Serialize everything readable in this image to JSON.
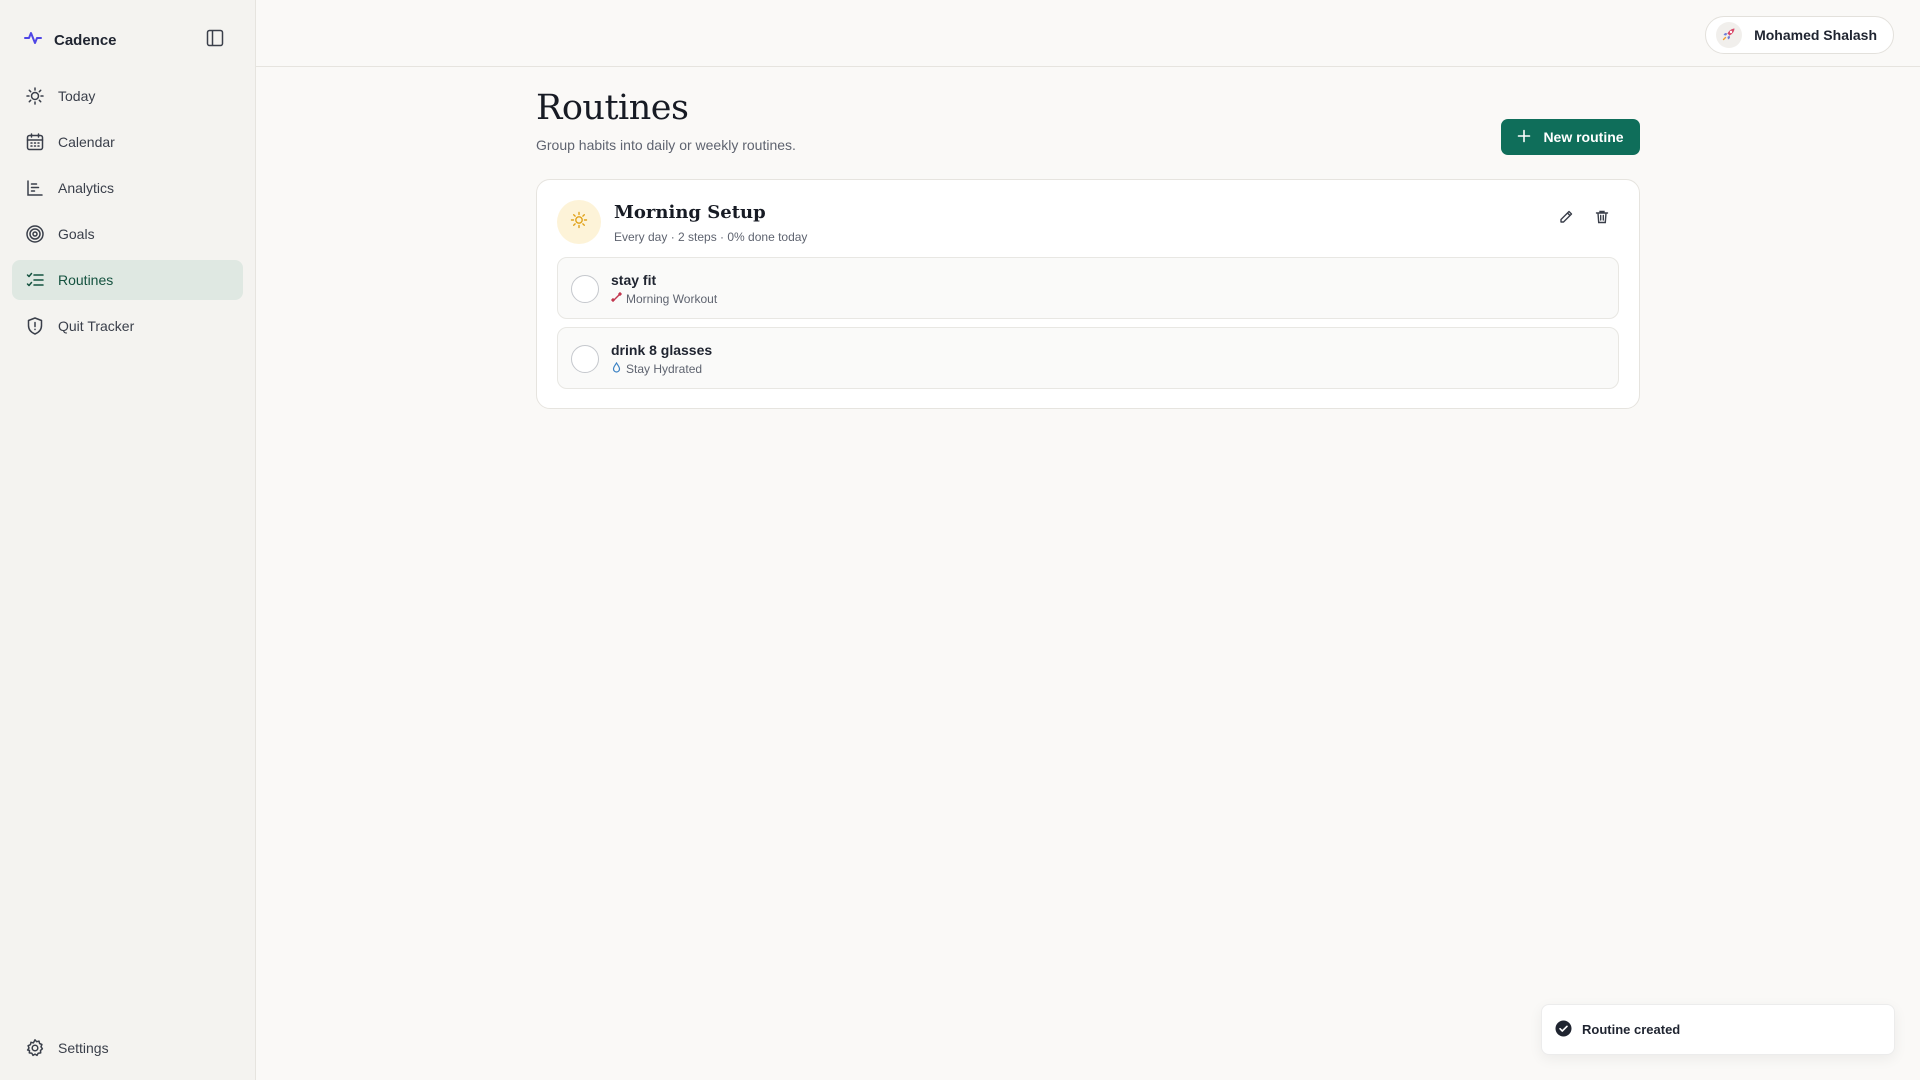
{
  "app": {
    "name": "Cadence",
    "accent": "#0f6e5a",
    "brand_icon": "pulse-icon"
  },
  "sidebar": {
    "items": [
      {
        "label": "Today",
        "icon": "sun-icon",
        "active": false
      },
      {
        "label": "Calendar",
        "icon": "calendar-icon",
        "active": false
      },
      {
        "label": "Analytics",
        "icon": "chart-icon",
        "active": false
      },
      {
        "label": "Goals",
        "icon": "target-icon",
        "active": false
      },
      {
        "label": "Routines",
        "icon": "checklist-icon",
        "active": true
      },
      {
        "label": "Quit Tracker",
        "icon": "shield-icon",
        "active": false
      }
    ],
    "settings_label": "Settings"
  },
  "header": {
    "user_name": "Mohamed Shalash",
    "avatar_icon": "rocket-icon"
  },
  "main": {
    "title": "Routines",
    "subtitle": "Group habits into daily or weekly routines.",
    "new_routine_label": "New routine",
    "routine": {
      "name": "Morning Setup",
      "meta": "Every day · 2 steps · 0% done today",
      "icon": "sun-icon",
      "steps": [
        {
          "title": "stay fit",
          "habit": "Morning Workout",
          "habit_icon": "dumbbell-icon"
        },
        {
          "title": "drink 8 glasses",
          "habit": "Stay Hydrated",
          "habit_icon": "droplet-icon"
        }
      ]
    }
  },
  "toast": {
    "message": "Routine created"
  }
}
